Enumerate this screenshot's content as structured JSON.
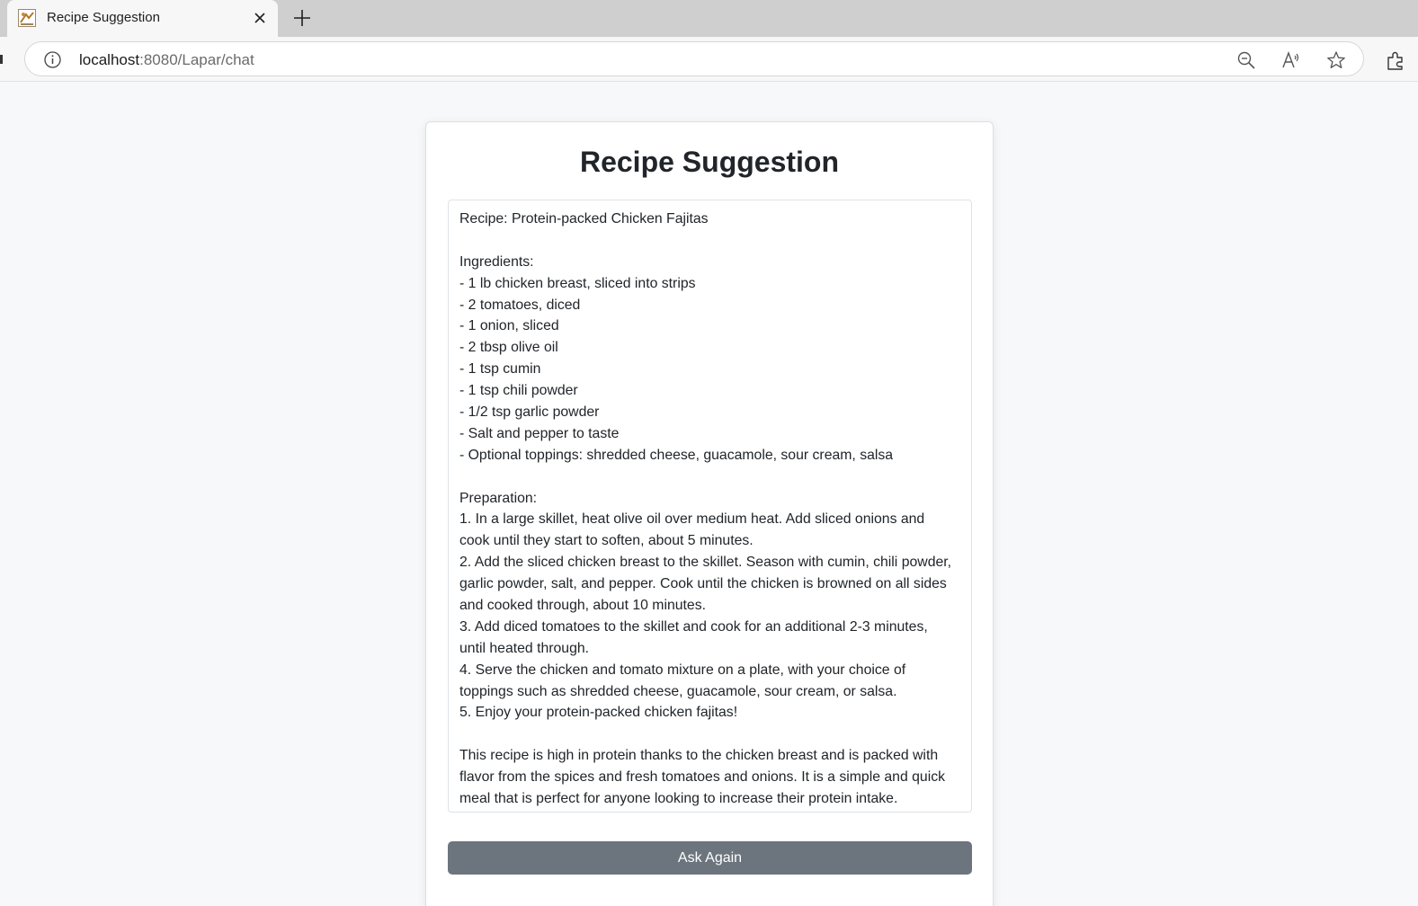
{
  "browser": {
    "tab_title": "Recipe Suggestion",
    "url_host": "localhost",
    "url_path": ":8080/Lapar/chat",
    "icons": [
      "favicon-icon",
      "close-icon",
      "plus-icon",
      "info-icon",
      "zoom-out-icon",
      "read-aloud-icon",
      "favorite-star-icon",
      "extensions-icon"
    ]
  },
  "page": {
    "title": "Recipe Suggestion",
    "recipe_lines": [
      "Recipe: Protein-packed Chicken Fajitas",
      "",
      "Ingredients:",
      "- 1 lb chicken breast, sliced into strips",
      "- 2 tomatoes, diced",
      "- 1 onion, sliced",
      "- 2 tbsp olive oil",
      "- 1 tsp cumin",
      "- 1 tsp chili powder",
      "- 1/2 tsp garlic powder",
      "- Salt and pepper to taste",
      "- Optional toppings: shredded cheese, guacamole, sour cream, salsa",
      "",
      "Preparation:",
      "1. In a large skillet, heat olive oil over medium heat. Add sliced onions and",
      "cook until they start to soften, about 5 minutes.",
      "2. Add the sliced chicken breast to the skillet. Season with cumin, chili powder,",
      "garlic powder, salt, and pepper. Cook until the chicken is browned on all sides",
      "and cooked through, about 10 minutes.",
      "3. Add diced tomatoes to the skillet and cook for an additional 2-3 minutes,",
      "until heated through.",
      "4. Serve the chicken and tomato mixture on a plate, with your choice of",
      "toppings such as shredded cheese, guacamole, sour cream, or salsa.",
      "5. Enjoy your protein-packed chicken fajitas!",
      "",
      "This recipe is high in protein thanks to the chicken breast and is packed with",
      "flavor from the spices and fresh tomatoes and onions. It is a simple and quick",
      "meal that is perfect for anyone looking to increase their protein intake."
    ],
    "ask_button_label": "Ask Again",
    "colors": {
      "button_bg": "#6c757d",
      "page_bg": "#f7f8f9",
      "text": "#212529"
    }
  }
}
